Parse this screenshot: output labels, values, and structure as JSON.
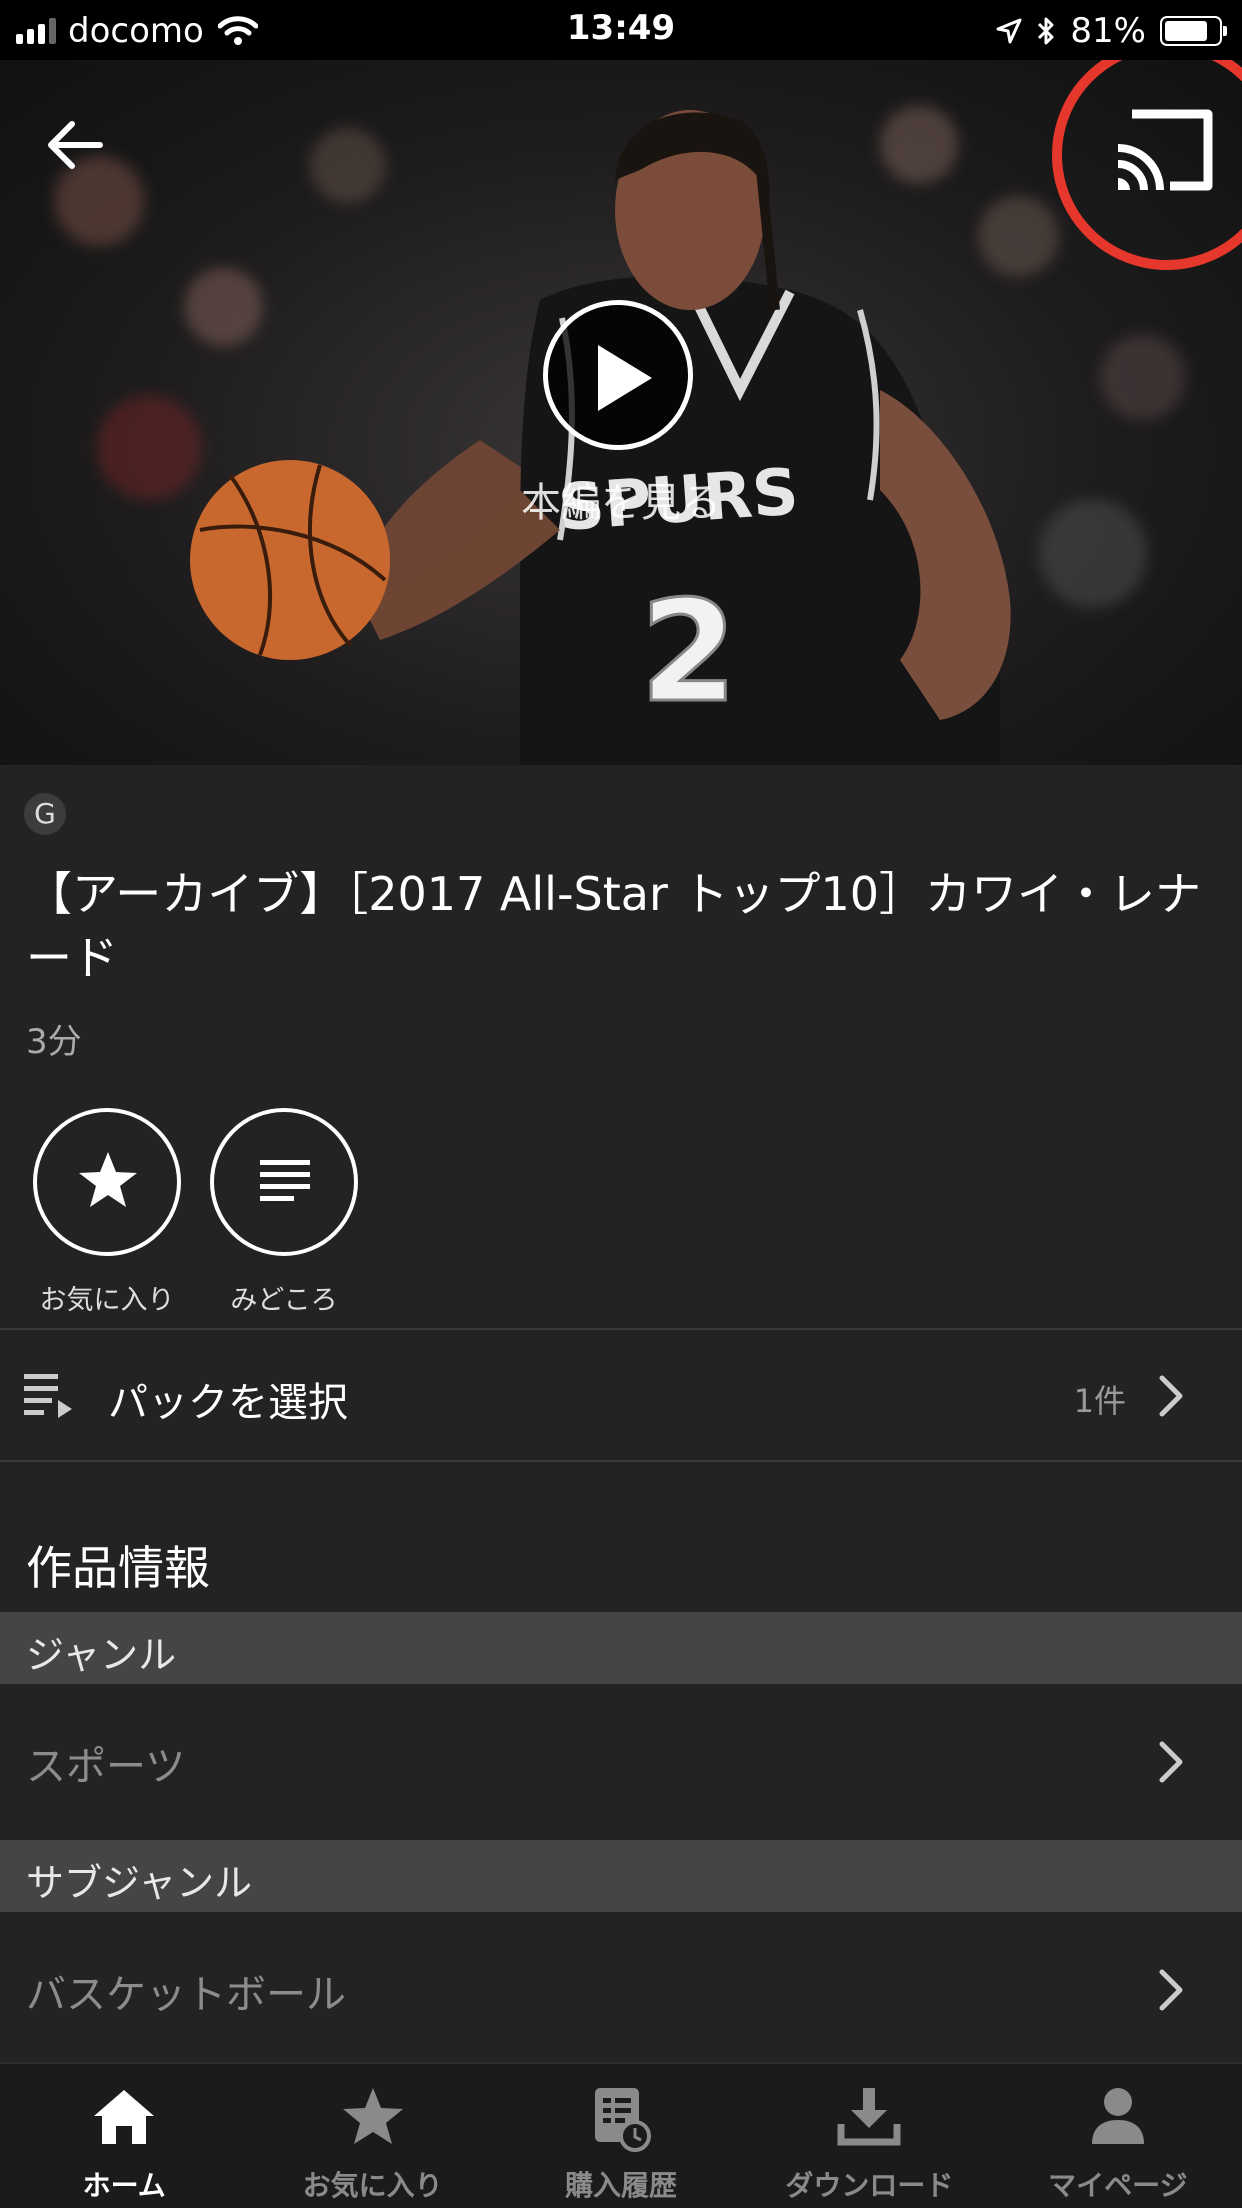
{
  "status_bar": {
    "carrier": "docomo",
    "time": "13:49",
    "battery_percent": "81%",
    "battery_level": 0.81
  },
  "hero": {
    "play_caption": "本編を見る"
  },
  "content": {
    "rating": "G",
    "title": "【アーカイブ】［2017 All-Star トップ10］カワイ・レナード",
    "duration": "3分"
  },
  "actions": {
    "favorite_label": "お気に入り",
    "highlights_label": "みどころ"
  },
  "pack": {
    "label": "パックを選択",
    "count": "1件"
  },
  "info": {
    "section_title": "作品情報",
    "genre_header": "ジャンル",
    "genre_value": "スポーツ",
    "subgenre_header": "サブジャンル",
    "subgenre_value": "バスケットボール"
  },
  "tabs": [
    {
      "label": "ホーム",
      "icon": "home-icon",
      "active": true
    },
    {
      "label": "お気に入り",
      "icon": "star-icon",
      "active": false
    },
    {
      "label": "購入履歴",
      "icon": "purchase-history-icon",
      "active": false
    },
    {
      "label": "ダウンロード",
      "icon": "download-icon",
      "active": false
    },
    {
      "label": "マイページ",
      "icon": "person-icon",
      "active": false
    }
  ],
  "colors": {
    "background": "#232323",
    "cast_highlight": "#e5372b",
    "group_header": "#454545"
  }
}
